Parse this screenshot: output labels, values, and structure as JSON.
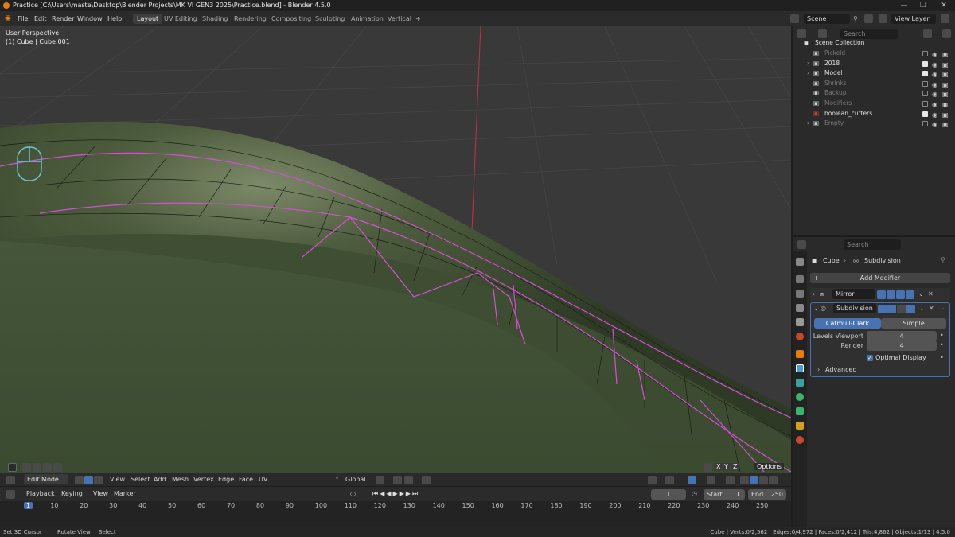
{
  "window": {
    "title": "Practice [C:\\Users\\maste\\Desktop\\Blender Projects\\MK VI GEN3 2025\\Practice.blend] - Blender 4.5.0",
    "controls": [
      "—",
      "❐",
      "✕"
    ]
  },
  "menu": {
    "items": [
      "File",
      "Edit",
      "Render",
      "Window",
      "Help"
    ],
    "tabs": [
      "Layout",
      "UV Editing",
      "Shading",
      "Rendering",
      "Compositing",
      "Sculpting",
      "Animation",
      "Vertical",
      "+"
    ],
    "active_tab": "Layout",
    "scene": "Scene",
    "view_layer": "View Layer"
  },
  "viewport": {
    "perspective": "User Perspective",
    "object": "(1) Cube | Cube.001",
    "axes": [
      "X",
      "Y",
      "Z"
    ],
    "options": "Options"
  },
  "viewport_header": {
    "mode": "Edit Mode",
    "menus": [
      "View",
      "Select",
      "Add",
      "Mesh",
      "Vertex",
      "Edge",
      "Face",
      "UV"
    ],
    "transform_orientation": "Global"
  },
  "timeline": {
    "menus": [
      "Playback",
      "Keying",
      "View",
      "Marker"
    ],
    "current_frame": "1",
    "start_label": "Start",
    "start": "1",
    "end_label": "End",
    "end": "250",
    "ticks": [
      "1",
      "10",
      "20",
      "30",
      "40",
      "50",
      "60",
      "70",
      "80",
      "90",
      "100",
      "110",
      "120",
      "130",
      "140",
      "150",
      "160",
      "170",
      "180",
      "190",
      "200",
      "210",
      "220",
      "230",
      "240",
      "250"
    ]
  },
  "outliner": {
    "search_placeholder": "Search",
    "root": "Scene Collection",
    "items": [
      {
        "name": "Pickeld",
        "enabled": false,
        "expand": false
      },
      {
        "name": "2018",
        "enabled": true,
        "expand": true
      },
      {
        "name": "Model",
        "enabled": true,
        "expand": true
      },
      {
        "name": "Shrinks",
        "enabled": false,
        "expand": false
      },
      {
        "name": "Backup",
        "enabled": false,
        "expand": false
      },
      {
        "name": "Modifiers",
        "enabled": false,
        "expand": false
      },
      {
        "name": "boolean_cutters",
        "enabled": true,
        "expand": false
      },
      {
        "name": "Empty",
        "enabled": false,
        "expand": true
      }
    ]
  },
  "properties": {
    "search_placeholder": "Search",
    "breadcrumb_object": "Cube",
    "breadcrumb_modifier": "Subdivision",
    "add_modifier": "Add Modifier",
    "modifiers": [
      {
        "name": "Mirror",
        "expanded": false
      },
      {
        "name": "Subdivision",
        "expanded": true
      }
    ],
    "subdivision": {
      "type_options": [
        "Catmull-Clark",
        "Simple"
      ],
      "active_type": "Catmull-Clark",
      "levels_viewport_label": "Levels Viewport",
      "levels_viewport": "4",
      "render_label": "Render",
      "render": "4",
      "optimal_display_label": "Optimal Display",
      "optimal_display": true,
      "advanced_label": "Advanced"
    }
  },
  "statusbar": {
    "hints": [
      "Set 3D Cursor",
      "Rotate View",
      "Select"
    ],
    "stats": "Cube | Verts:0/2,562 | Edges:0/4,972 | Faces:0/2,412 | Tris:4,862 | Objects:1/13 | 4.5.0"
  },
  "colors": {
    "accent_blue": "#4772b3",
    "selected_edge": "#d64fd6",
    "mesh_green": "#4a5a3a",
    "x_axis_red": "#c0343d",
    "collection_orange": "#e87d0d"
  }
}
